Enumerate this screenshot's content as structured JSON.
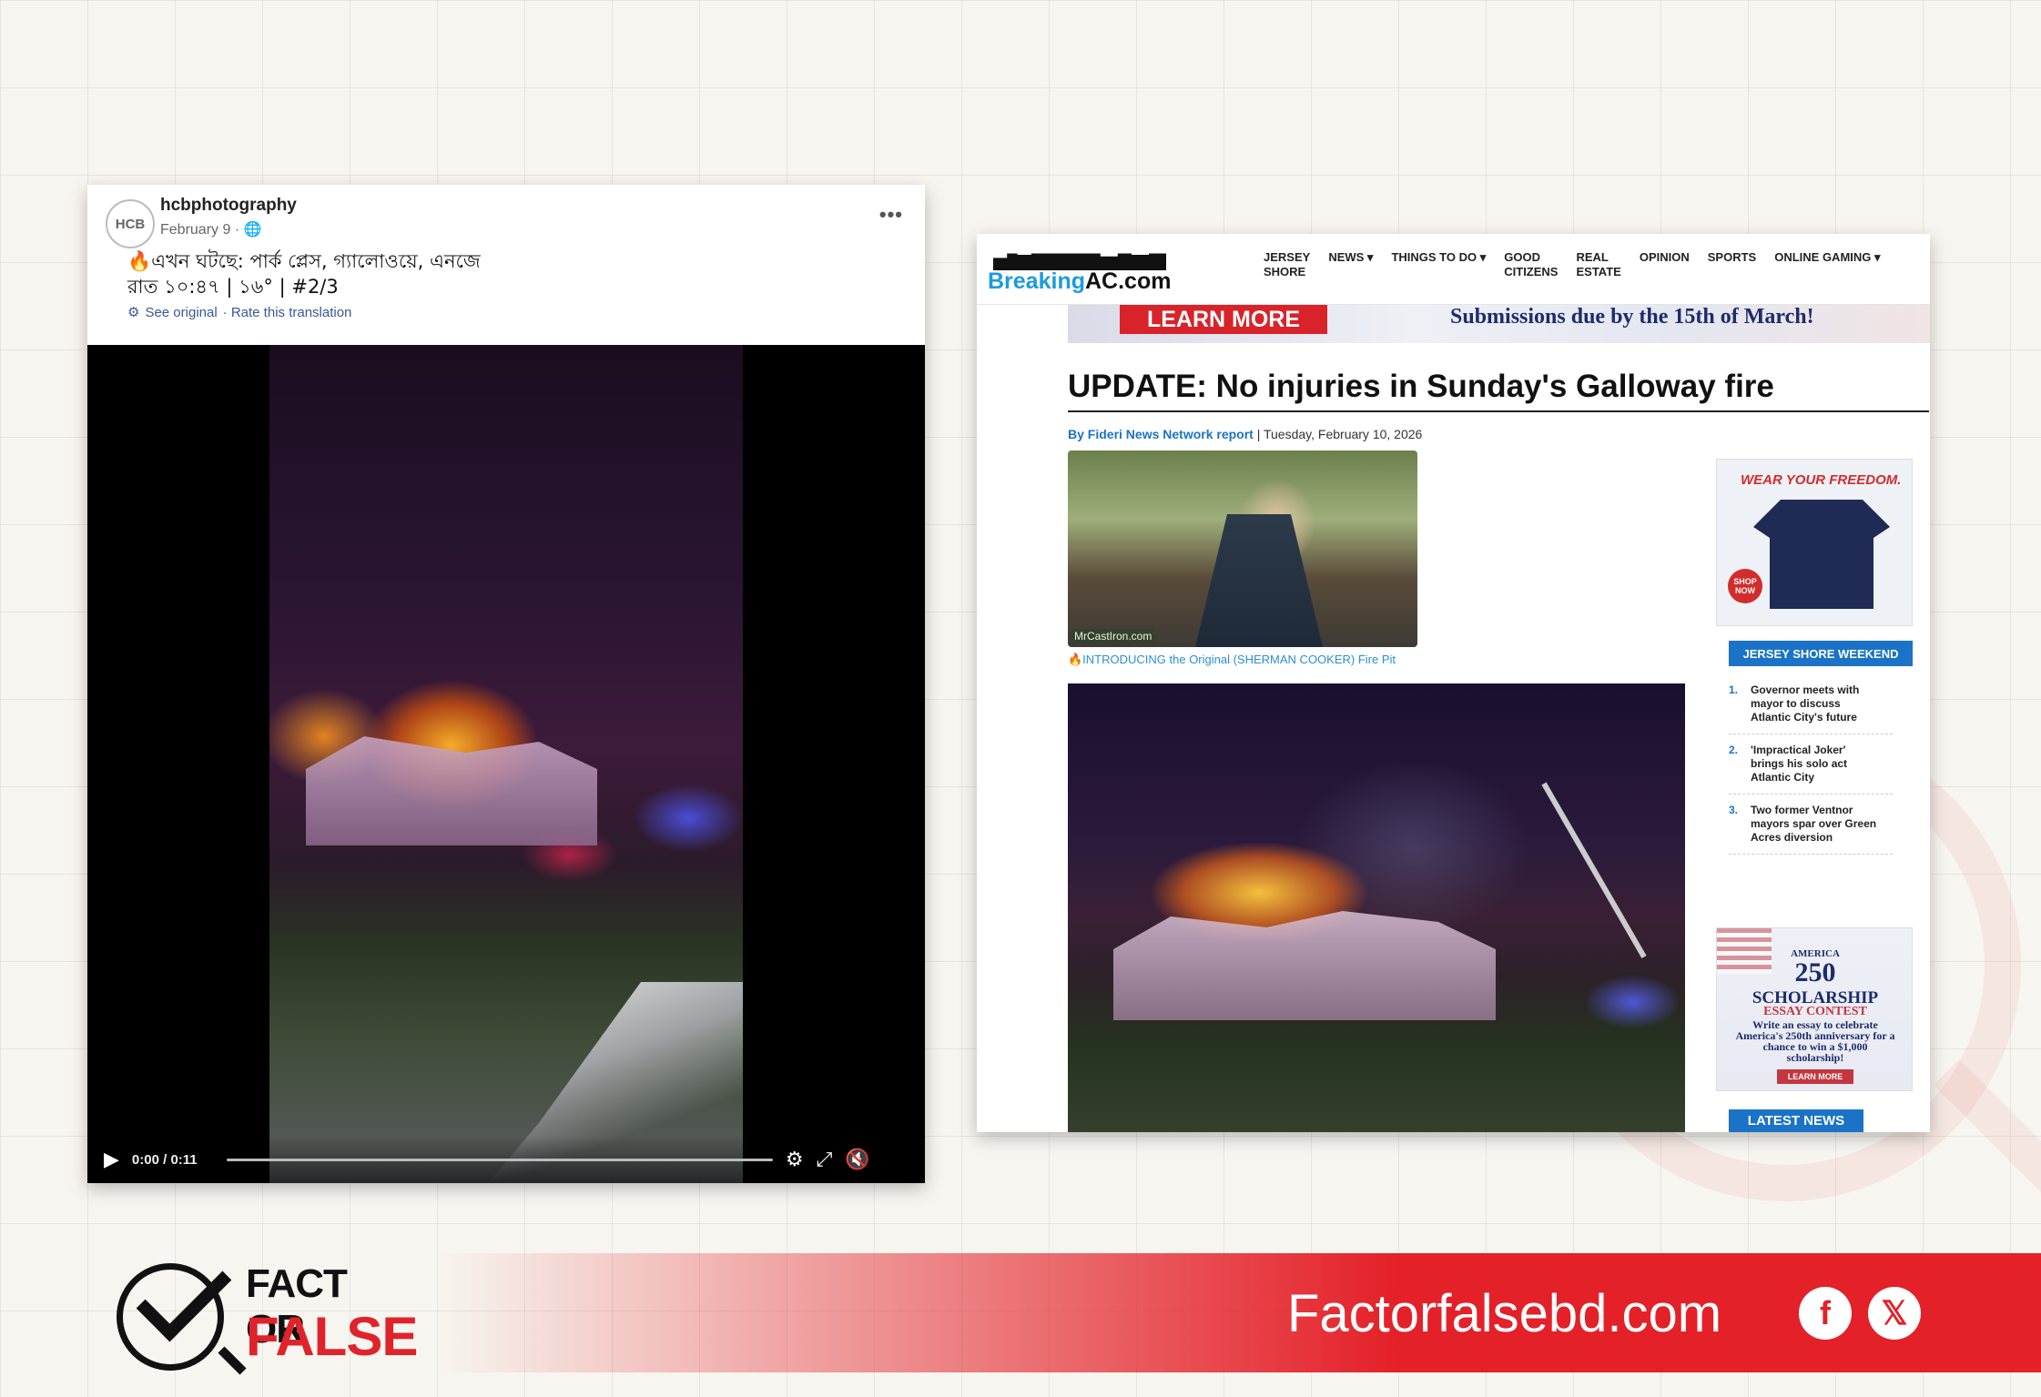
{
  "facebook_post": {
    "avatar_text": "HCB",
    "author": "hcbphotography",
    "date": "February 9 · 🌐",
    "more": "•••",
    "text_line1": "🔥এখন ঘটছে: পার্ক প্লেস, গ্যালোওয়ে, এনজে",
    "text_line2": "রাত ১০:৪৭ | ১৬° | #2/3",
    "see_original": "See original",
    "rate_translation": "· Rate this translation",
    "video": {
      "time": "0:00 / 0:11",
      "progress": 0.0
    }
  },
  "breakingac": {
    "logo_prefix": "Breaking",
    "logo_suffix": "AC.com",
    "nav": [
      "Jersey\nShore",
      "News ▾",
      "Things to do ▾",
      "Good\nCitizens",
      "Real\nEstate",
      "Opinion",
      "Sports",
      "Online Gaming ▾"
    ],
    "banner": {
      "button": "LEARN MORE",
      "text": "Submissions due by the 15th of March!"
    },
    "headline": "UPDATE: No injuries in Sunday's Galloway fire",
    "byline_author": "By Fideri News Network report",
    "byline_date": " | Tuesday, February 10, 2026",
    "ad_watermark": "MrCastIron.com",
    "ad_caption": "🔥INTRODUCING the Original (SHERMAN COOKER) Fire Pit",
    "side_ad": {
      "title": "WEAR YOUR FREEDOM.",
      "badge": "SHOP NOW"
    },
    "section_label": "JERSEY SHORE WEEKEND",
    "list": [
      {
        "num": "1.",
        "text": "Governor meets with mayor to discuss Atlantic City's future"
      },
      {
        "num": "2.",
        "text": "'Impractical Joker' brings his solo act Atlantic City"
      },
      {
        "num": "3.",
        "text": "Two former Ventnor mayors spar over Green Acres diversion"
      }
    ],
    "scholarship": {
      "line1": "AMERICA",
      "number": "250",
      "title": "SCHOLARSHIP",
      "subtitle": "ESSAY CONTEST",
      "desc": "Write an essay to celebrate America's 250th anniversary for a chance to win a $1,000 scholarship!",
      "button": "LEARN MORE"
    },
    "latest_label": "LATEST NEWS"
  },
  "branding": {
    "logo_top": "FACT OR",
    "logo_bottom": "FALSE",
    "site": "Factorfalsebd.com",
    "social": [
      "f",
      "𝕏"
    ]
  },
  "colors": {
    "brand_red": "#e42028",
    "bac_blue": "#1a73c7"
  }
}
